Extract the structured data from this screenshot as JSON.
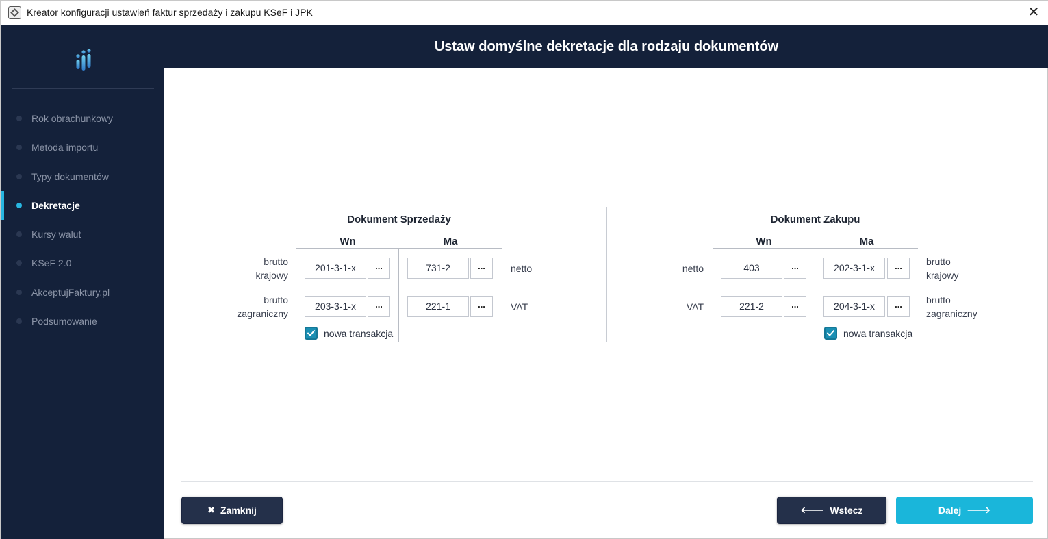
{
  "window": {
    "title": "Kreator konfiguracji ustawień faktur sprzedaży i zakupu KSeF i JPK",
    "close_symbol": "✕"
  },
  "sidebar": {
    "items": [
      {
        "label": "Rok obrachunkowy",
        "active": false
      },
      {
        "label": "Metoda importu",
        "active": false
      },
      {
        "label": "Typy dokumentów",
        "active": false
      },
      {
        "label": "Dekretacje",
        "active": true
      },
      {
        "label": "Kursy walut",
        "active": false
      },
      {
        "label": "KSeF 2.0",
        "active": false
      },
      {
        "label": "AkceptujFaktury.pl",
        "active": false
      },
      {
        "label": "Podsumowanie",
        "active": false
      }
    ]
  },
  "header": {
    "title": "Ustaw domyślne dekretacje dla rodzaju dokumentów"
  },
  "sales": {
    "title": "Dokument Sprzedaży",
    "col_wn": "Wn",
    "col_ma": "Ma",
    "row1_label_line1": "brutto",
    "row1_label_line2": "krajowy",
    "row1_wn": "201-3-1-x",
    "row1_ma": "731-2",
    "row1_right_label": "netto",
    "row2_label_line1": "brutto",
    "row2_label_line2": "zagraniczny",
    "row2_wn": "203-3-1-x",
    "row2_ma": "221-1",
    "row2_right_label": "VAT",
    "checkbox_label": "nowa transakcja",
    "checkbox_checked": true
  },
  "purchase": {
    "title": "Dokument Zakupu",
    "col_wn": "Wn",
    "col_ma": "Ma",
    "row1_left_label": "netto",
    "row1_wn": "403",
    "row1_ma": "202-3-1-x",
    "row1_label_line1": "brutto",
    "row1_label_line2": "krajowy",
    "row2_left_label": "VAT",
    "row2_wn": "221-2",
    "row2_ma": "204-3-1-x",
    "row2_label_line1": "brutto",
    "row2_label_line2": "zagraniczny",
    "checkbox_label": "nowa transakcja",
    "checkbox_checked": true
  },
  "browse_button_label": "...",
  "footer": {
    "close_label": "Zamknij",
    "back_label": "Wstecz",
    "next_label": "Dalej"
  },
  "colors": {
    "sidebar_bg": "#14213a",
    "accent": "#1ab6da",
    "checkbox": "#1a8fb3"
  }
}
